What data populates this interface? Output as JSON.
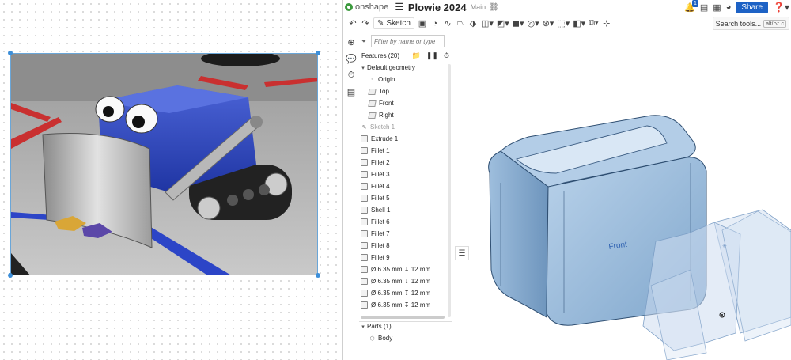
{
  "app": {
    "logo_text": "onshape",
    "document_title": "Plowie 2024",
    "branch": "Main",
    "notification_count": "1",
    "share_label": "Share",
    "accent": "#1d62c5"
  },
  "toolbar": {
    "sketch_label": "Sketch",
    "search_tools_label": "Search tools...",
    "search_shortcut": "alt/⌥ c"
  },
  "feature_panel": {
    "filter_placeholder": "Filter by name or type",
    "header": "Features (20)",
    "default_geometry": "Default geometry",
    "geometry_items": [
      "Origin",
      "Top",
      "Front",
      "Right"
    ],
    "features": [
      "Sketch 1",
      "Extrude 1",
      "Fillet 1",
      "Fillet 2",
      "Fillet 3",
      "Fillet 4",
      "Fillet 5",
      "Shell 1",
      "Fillet 6",
      "Fillet 7",
      "Fillet 8",
      "Fillet 9",
      "Ø 6.35 mm ↧ 12 mm",
      "Ø 6.35 mm ↧ 12 mm",
      "Ø 6.35 mm ↧ 12 mm",
      "Ø 6.35 mm ↧ 12 mm"
    ],
    "parts_header": "Parts (1)",
    "parts": [
      "Body"
    ]
  },
  "viewport": {
    "plane_label": "Front",
    "part_color": "#a9c6e3"
  }
}
